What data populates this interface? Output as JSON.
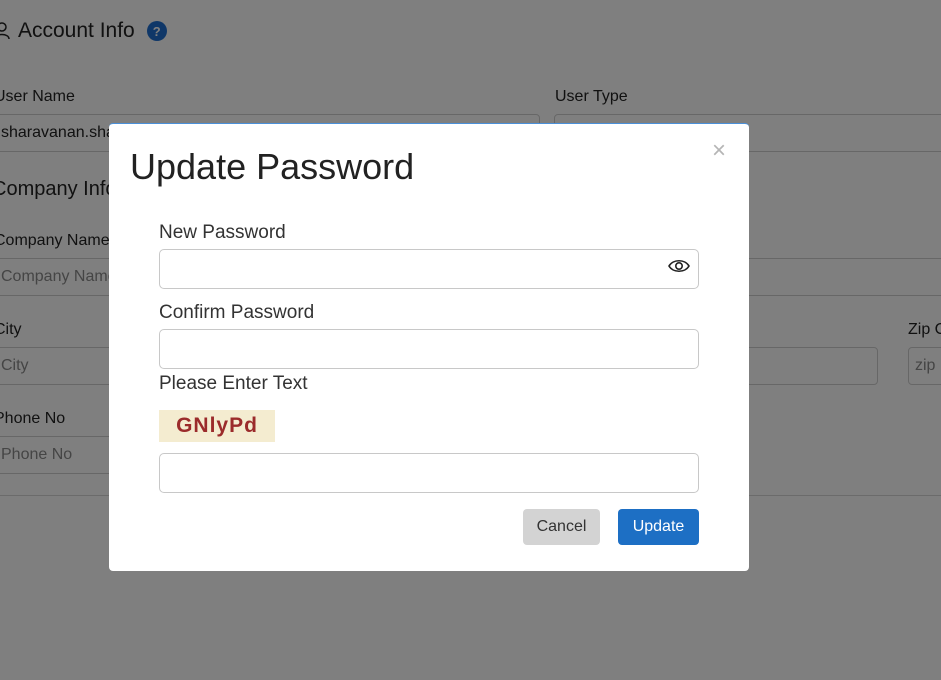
{
  "account": {
    "title": "Account Info",
    "help": "?"
  },
  "form": {
    "user_name_label": "User Name",
    "user_name_value": "sharavanan.sha",
    "user_type_label": "User Type",
    "company_section": "Company Info",
    "company_name_label": "Company Name",
    "company_name_placeholder": "Company Name",
    "city_label": "City",
    "city_placeholder": "City",
    "zip_label": "Zip Code",
    "zip_placeholder": "zip",
    "phone_label": "Phone No",
    "phone_placeholder": "Phone No"
  },
  "modal": {
    "title": "Update Password",
    "close": "×",
    "new_password_label": "New Password",
    "confirm_password_label": "Confirm Password",
    "captcha_label": "Please Enter Text",
    "captcha_text": "GNlyPd",
    "cancel_label": "Cancel",
    "update_label": "Update"
  },
  "colors": {
    "primary": "#1d6fc4",
    "help": "#1f6fd1",
    "captcha_text": "#9b2b2b",
    "captcha_bg": "#f4ecd0"
  }
}
